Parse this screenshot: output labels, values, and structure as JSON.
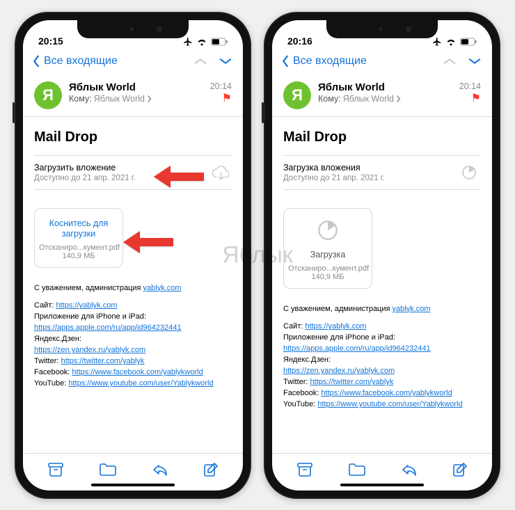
{
  "watermark": "Яблык",
  "phones": [
    {
      "time": "20:15",
      "nav_back": "Все входящие",
      "sender": "Яблык World",
      "avatar_initial": "Я",
      "to_label": "Кому:",
      "to_name": "Яблык World",
      "msg_time": "20:14",
      "subject": "Mail Drop",
      "maildrop_title": "Загрузить вложение",
      "maildrop_sub": "Доступно до 21 апр. 2021 г.",
      "attachment_title": "Коснитесь для загрузки",
      "attachment_name": "Отсканиро...кумент.pdf",
      "attachment_size": "140,9 МБ",
      "sig_intro": "С уважением, администрация ",
      "sig_domain": "yablyk.com",
      "sig_lines": {
        "site_lbl": "Сайт: ",
        "site_url": "https://yablyk.com",
        "app_lbl": "Приложение для iPhone и iPad:",
        "app_url": "https://apps.apple.com/ru/app/id964232441",
        "dzen_lbl": "Яндекс.Дзен:",
        "dzen_url": "https://zen.yandex.ru/yablyk.com",
        "tw_lbl": "Twitter: ",
        "tw_url": "https://twitter.com/yablyk",
        "fb_lbl": "Facebook: ",
        "fb_url": "https://www.facebook.com/yablykworld",
        "yt_lbl": "YouTube: ",
        "yt_url": "https://www.youtube.com/user/Yablykworld"
      },
      "maildrop_state": "idle",
      "show_arrows": true
    },
    {
      "time": "20:16",
      "nav_back": "Все входящие",
      "sender": "Яблык World",
      "avatar_initial": "Я",
      "to_label": "Кому:",
      "to_name": "Яблык World",
      "msg_time": "20:14",
      "subject": "Mail Drop",
      "maildrop_title": "Загрузка вложения",
      "maildrop_sub": "Доступно до 21 апр. 2021 г.",
      "attachment_title": "Загрузка",
      "attachment_name": "Отсканиро...кумент.pdf",
      "attachment_size": "140,9 МБ",
      "sig_intro": "С уважением, администрация ",
      "sig_domain": "yablyk.com",
      "sig_lines": {
        "site_lbl": "Сайт: ",
        "site_url": "https://yablyk.com",
        "app_lbl": "Приложение для iPhone и iPad:",
        "app_url": "https://apps.apple.com/ru/app/id964232441",
        "dzen_lbl": "Яндекс.Дзен:",
        "dzen_url": "https://zen.yandex.ru/yablyk.com",
        "tw_lbl": "Twitter: ",
        "tw_url": "https://twitter.com/yablyk",
        "fb_lbl": "Facebook: ",
        "fb_url": "https://www.facebook.com/yablykworld",
        "yt_lbl": "YouTube: ",
        "yt_url": "https://www.youtube.com/user/Yablykworld"
      },
      "maildrop_state": "loading",
      "show_arrows": false
    }
  ]
}
